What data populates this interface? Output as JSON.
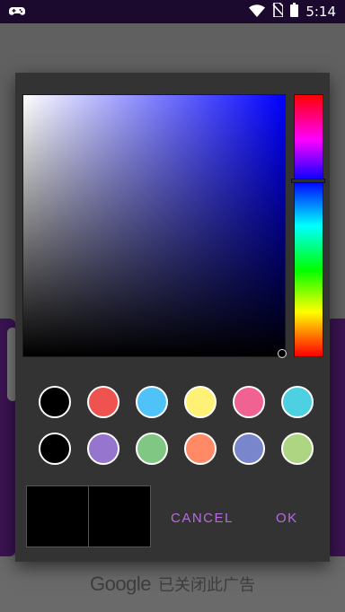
{
  "status_bar": {
    "time": "5:14",
    "icons": [
      "gamepad-icon",
      "wifi-icon",
      "no-sim-icon",
      "battery-icon"
    ]
  },
  "ad_banner": {
    "brand": "Google",
    "text": "已关闭此广告"
  },
  "color_picker": {
    "saturation_value_area": {
      "hue": "#0000ff",
      "selected_color": "#000000"
    },
    "hue_slider": {
      "selected_hue": "#0000ff"
    },
    "swatches": [
      [
        "#000000",
        "#ef5350",
        "#4fc3f7",
        "#fff176",
        "#f06292",
        "#4dd0e1"
      ],
      [
        "#000000",
        "#9575cd",
        "#81c784",
        "#ff8a65",
        "#7986cb",
        "#aed581"
      ]
    ],
    "preview": {
      "old_color": "#000000",
      "new_color": "#000000"
    },
    "buttons": {
      "cancel": "CANCEL",
      "ok": "OK"
    },
    "accent_color": "#b76be0"
  }
}
